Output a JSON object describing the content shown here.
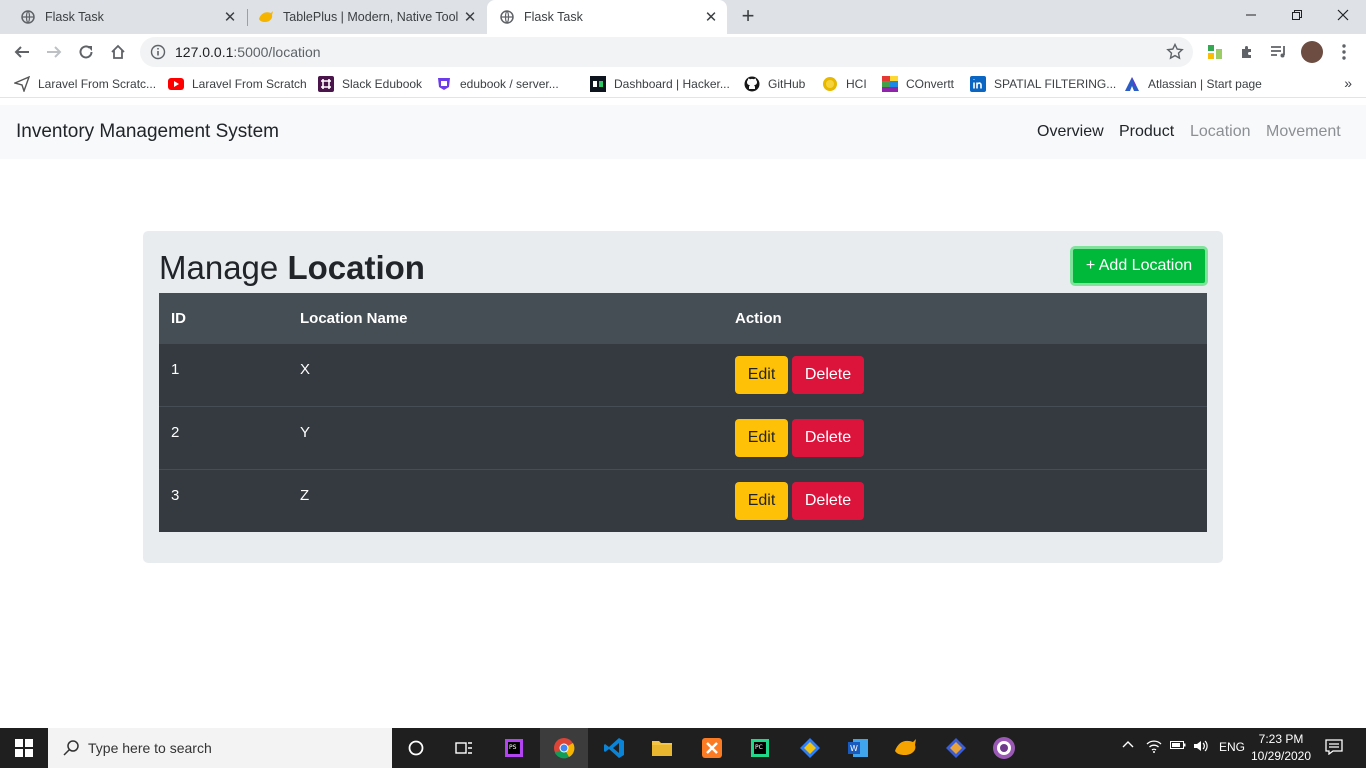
{
  "browser": {
    "tabs": [
      {
        "title": "Flask Task",
        "icon": "globe-icon"
      },
      {
        "title": "TablePlus | Modern, Native Tool f",
        "icon": "tableplus-icon"
      },
      {
        "title": "Flask Task",
        "icon": "globe-icon",
        "active": true
      }
    ],
    "url": {
      "host": "127.0.0.1",
      "path": ":5000/location"
    },
    "bookmarks": [
      {
        "label": "Laravel From Scratc...",
        "icon": "send-icon"
      },
      {
        "label": "Laravel From Scratch",
        "icon": "youtube-icon"
      },
      {
        "label": "Slack Edubook",
        "icon": "slack-icon"
      },
      {
        "label": "edubook / server...",
        "icon": "gitlab-icon"
      },
      {
        "label": "Dashboard | Hacker...",
        "icon": "hackerrank-icon"
      },
      {
        "label": "GitHub",
        "icon": "github-icon"
      },
      {
        "label": "HCI",
        "icon": "hci-icon"
      },
      {
        "label": "COnvertt",
        "icon": "convertt-icon"
      },
      {
        "label": "SPATIAL FILTERING...",
        "icon": "linkedin-icon"
      },
      {
        "label": "Atlassian | Start page",
        "icon": "atlassian-icon"
      }
    ]
  },
  "app": {
    "brand": "Inventory Management System",
    "nav": [
      "Overview",
      "Product",
      "Location",
      "Movement"
    ],
    "heading_light": "Manage ",
    "heading_bold": "Location",
    "add_button": "+ Add Location",
    "table": {
      "headers": [
        "ID",
        "Location Name",
        "Action"
      ],
      "rows": [
        {
          "id": "1",
          "name": "X"
        },
        {
          "id": "2",
          "name": "Y"
        },
        {
          "id": "3",
          "name": "Z"
        }
      ],
      "edit_label": "Edit",
      "delete_label": "Delete"
    }
  },
  "taskbar": {
    "search_placeholder": "Type here to search",
    "language": "ENG",
    "time": "7:23 PM",
    "date": "10/29/2020"
  },
  "colors": {
    "add_button": "#00b93a",
    "edit_button": "#ffc107",
    "delete_button": "#dc143c",
    "table_body": "#343a40",
    "table_head": "#454d55",
    "panel": "#e9ecef"
  }
}
